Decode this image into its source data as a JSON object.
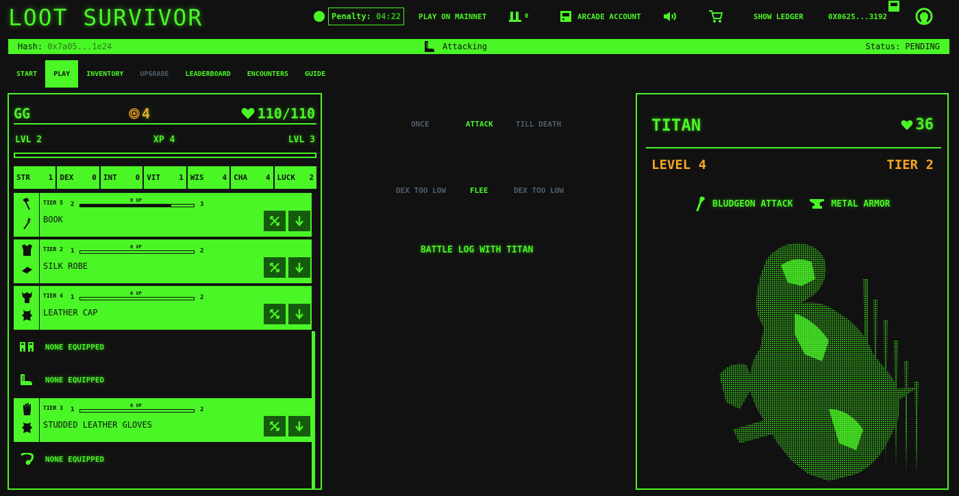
{
  "header": {
    "logo": "LOOT SURVIVOR",
    "penalty_label": "Penalty:",
    "penalty_time": "04:22",
    "play_mainnet": "PLAY ON MAINNET",
    "lords_count": "0",
    "arcade_account": "ARCADE ACCOUNT",
    "show_ledger": "SHOW LEDGER",
    "address": "0X0625...3192",
    "icons": [
      "status-dot-icon",
      "lords-icon",
      "arcade-icon",
      "sound-icon",
      "cart-icon",
      "wallet-icon",
      "github-icon"
    ]
  },
  "hashbar": {
    "hash_label": "Hash:",
    "hash_value": "0x7a05...1e24",
    "action": "Attacking",
    "status": "Status: PENDING"
  },
  "nav": {
    "tabs": [
      {
        "label": "START",
        "state": "normal"
      },
      {
        "label": "PLAY",
        "state": "active"
      },
      {
        "label": "INVENTORY",
        "state": "normal"
      },
      {
        "label": "UPGRADE",
        "state": "disabled"
      },
      {
        "label": "LEADERBOARD",
        "state": "normal"
      },
      {
        "label": "ENCOUNTERS",
        "state": "normal"
      },
      {
        "label": "GUIDE",
        "state": "normal"
      }
    ]
  },
  "adventurer": {
    "name": "GG",
    "gold": "4",
    "health": "110/110",
    "level_label": "LVL 2",
    "xp_label": "XP 4",
    "next_level_label": "LVL 3",
    "xp_progress": 0,
    "stats": [
      {
        "name": "STR",
        "value": "1"
      },
      {
        "name": "DEX",
        "value": "0"
      },
      {
        "name": "INT",
        "value": "0"
      },
      {
        "name": "VIT",
        "value": "1"
      },
      {
        "name": "WIS",
        "value": "4"
      },
      {
        "name": "CHA",
        "value": "4"
      },
      {
        "name": "LUCK",
        "value": "2"
      }
    ],
    "equipment": [
      {
        "slot": "weapon",
        "tier": "TIER 5",
        "lvl_a": "2",
        "lvl_b": "3",
        "xp": "8 XP",
        "progress": 0.8,
        "name": "BOOK"
      },
      {
        "slot": "chest",
        "tier": "TIER 2",
        "lvl_a": "1",
        "lvl_b": "2",
        "xp": "0 XP",
        "progress": 0,
        "name": "SILK ROBE"
      },
      {
        "slot": "head",
        "tier": "TIER 4",
        "lvl_a": "1",
        "lvl_b": "2",
        "xp": "0 XP",
        "progress": 0,
        "name": "LEATHER CAP"
      },
      {
        "slot": "waist",
        "none": "NONE EQUIPPED"
      },
      {
        "slot": "foot",
        "none": "NONE EQUIPPED"
      },
      {
        "slot": "hand",
        "tier": "TIER 3",
        "lvl_a": "1",
        "lvl_b": "2",
        "xp": "0 XP",
        "progress": 0,
        "name": "STUDDED LEATHER GLOVES"
      },
      {
        "slot": "neck",
        "none": "NONE EQUIPPED"
      }
    ]
  },
  "actions": {
    "attack_once": "ONCE",
    "attack": "ATTACK",
    "attack_till_death": "TILL DEATH",
    "flee_once": "DEX TOO LOW",
    "flee": "FLEE",
    "flee_till_death": "DEX TOO LOW",
    "battle_log": "BATTLE LOG WITH TITAN"
  },
  "beast": {
    "name": "TITAN",
    "health": "36",
    "level": "LEVEL 4",
    "tier": "TIER 2",
    "attack_type": "BLUDGEON ATTACK",
    "armor_type": "METAL ARMOR"
  },
  "colors": {
    "accent": "#4af626",
    "background": "#111111",
    "gold": "#f5a623",
    "disabled": "#4d5f6e",
    "button_dark": "#165a0e"
  }
}
